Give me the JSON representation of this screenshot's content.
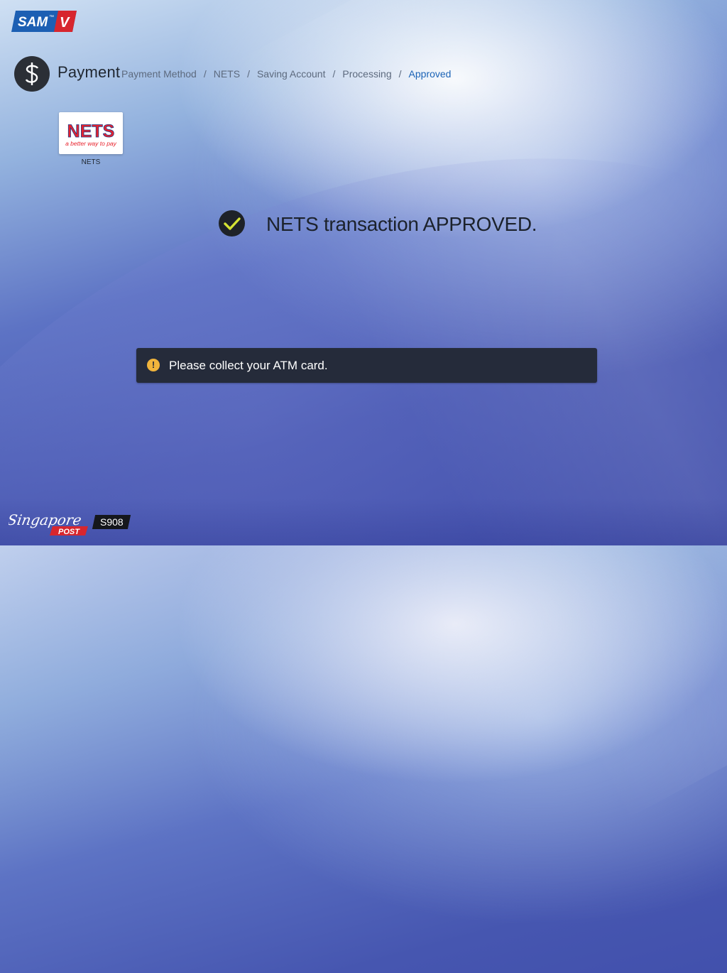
{
  "brand": {
    "logo_text": "SAM",
    "logo_tm": "™",
    "logo_suffix": "V"
  },
  "header": {
    "icon": "dollar-icon",
    "title": "Payment",
    "breadcrumb": [
      "Payment Method",
      "NETS",
      "Saving Account",
      "Processing",
      "Approved"
    ],
    "separator": "/"
  },
  "payment_method": {
    "logo_text": "NETS",
    "tagline": "a better way to pay",
    "label": "NETS"
  },
  "status": {
    "icon": "check-circle-icon",
    "message": "NETS transaction APPROVED."
  },
  "notice": {
    "icon": "warning-icon",
    "icon_glyph": "!",
    "message": "Please collect your ATM card."
  },
  "footer": {
    "logo_script": "Singapore",
    "logo_post": "POST",
    "kiosk_id": "S908"
  },
  "colors": {
    "accent_blue": "#1b63b6",
    "check_color": "#d4e334",
    "warning": "#f0b43c",
    "nets_red": "#e8222c",
    "nets_blue": "#1e3f8f"
  }
}
